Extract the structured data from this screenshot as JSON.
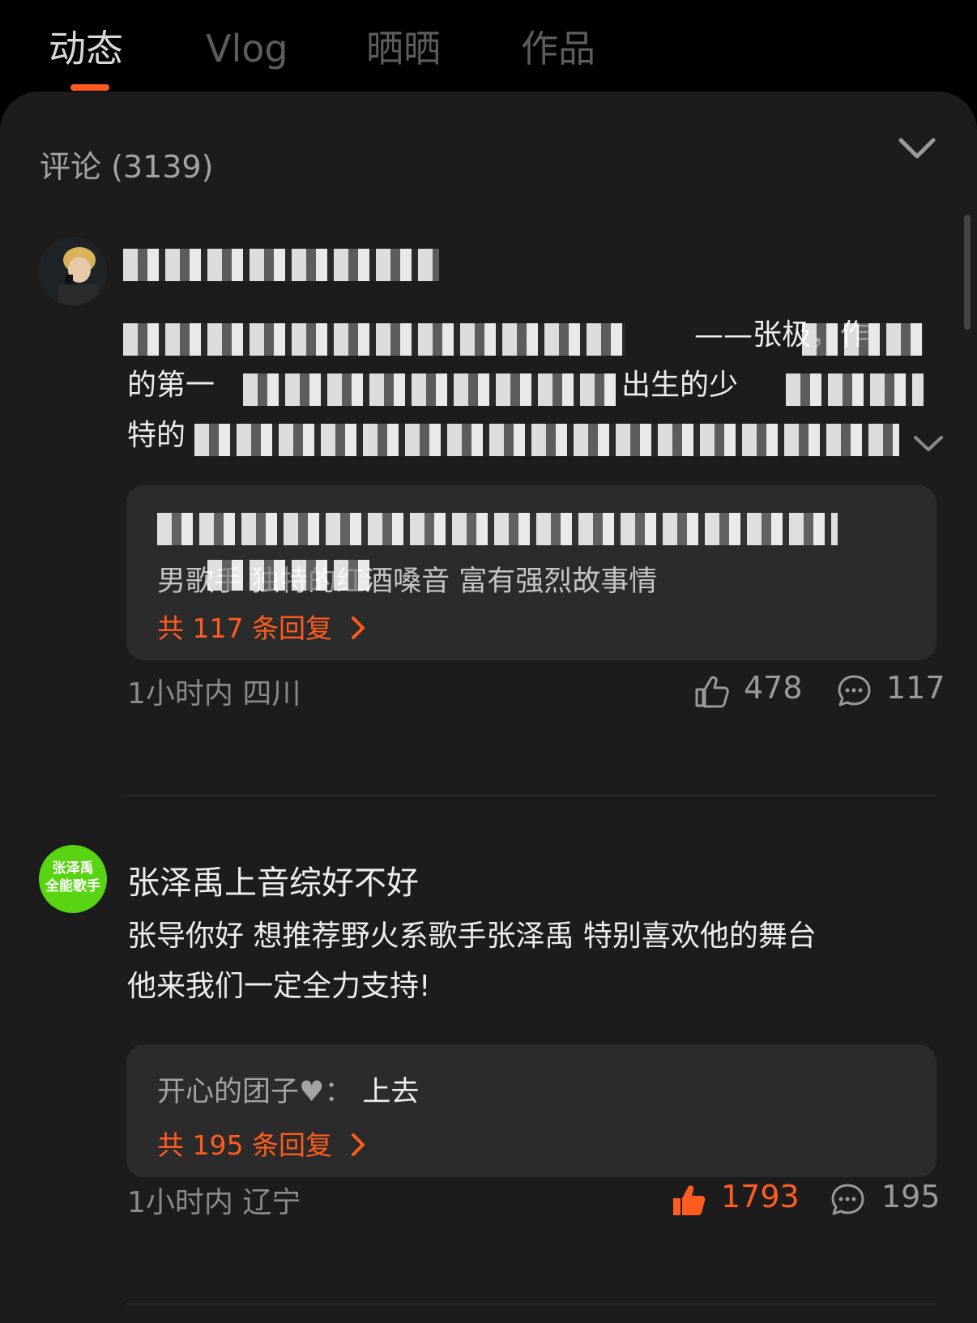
{
  "tabs": [
    {
      "label": "动态"
    },
    {
      "label": "Vlog"
    },
    {
      "label": "晒晒"
    },
    {
      "label": "作品"
    }
  ],
  "accent_color": "#ff5c1f",
  "comments_header": {
    "title": "评论 (3139)"
  },
  "comments": [
    {
      "username": "",
      "text_lines": [
        "——张极，作",
        "的第一",
        "出生的少",
        "特的"
      ],
      "reply_preview": "男歌手 独特的红酒嗓音 富有强烈故事情",
      "reply_count_label": "共 117 条回复",
      "meta": "1小时内 四川",
      "likes": "478",
      "replies": "117",
      "liked": false
    },
    {
      "username": "张泽禹上音综好不好",
      "avatar_text": [
        "张泽禹",
        "全能歌手"
      ],
      "text_lines": [
        "张导你好 想推荐野火系歌手张泽禹 特别喜欢他的舞台",
        "他来我们一定全力支持!"
      ],
      "reply_preview_user": "开心的团子♥：",
      "reply_preview_text": "上去",
      "reply_count_label": "共 195 条回复",
      "meta": "1小时内 辽宁",
      "likes": "1793",
      "replies": "195",
      "liked": true
    }
  ]
}
